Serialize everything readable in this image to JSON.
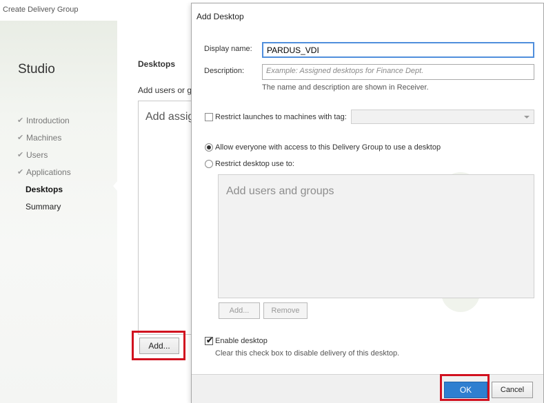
{
  "background_wizard": {
    "window_title": "Create Delivery Group",
    "brand": "Studio",
    "nav": [
      {
        "label": "Introduction",
        "state": "done"
      },
      {
        "label": "Machines",
        "state": "done"
      },
      {
        "label": "Users",
        "state": "done"
      },
      {
        "label": "Applications",
        "state": "done"
      },
      {
        "label": "Desktops",
        "state": "active"
      },
      {
        "label": "Summary",
        "state": "pending"
      }
    ],
    "page_heading": "Desktops",
    "page_subtext": "Add users or gro",
    "list_placeholder": "Add assign",
    "add_button_label": "Add..."
  },
  "dialog": {
    "title": "Add Desktop",
    "display_name_label": "Display name:",
    "display_name_value": "PARDUS_VDI",
    "description_label": "Description:",
    "description_placeholder": "Example: Assigned desktops for Finance Dept.",
    "name_hint": "The name and description are shown in Receiver.",
    "restrict_tag_label": "Restrict launches to machines with tag:",
    "restrict_tag_checked": false,
    "access": {
      "selected": "everyone",
      "everyone_label": "Allow everyone with access to this Delivery Group to use a desktop",
      "restrict_label": "Restrict desktop use to:"
    },
    "users_box_placeholder": "Add users and groups",
    "users_add_button": "Add...",
    "users_remove_button": "Remove",
    "enable_desktop_label": "Enable desktop",
    "enable_desktop_checked": true,
    "enable_desktop_hint": "Clear this check box to disable delivery of this desktop.",
    "ok_button": "OK",
    "cancel_button": "Cancel"
  },
  "colors": {
    "highlight_box": "#d1101f",
    "primary_button": "#2f7fd0",
    "focus_border": "#4f8edc"
  }
}
